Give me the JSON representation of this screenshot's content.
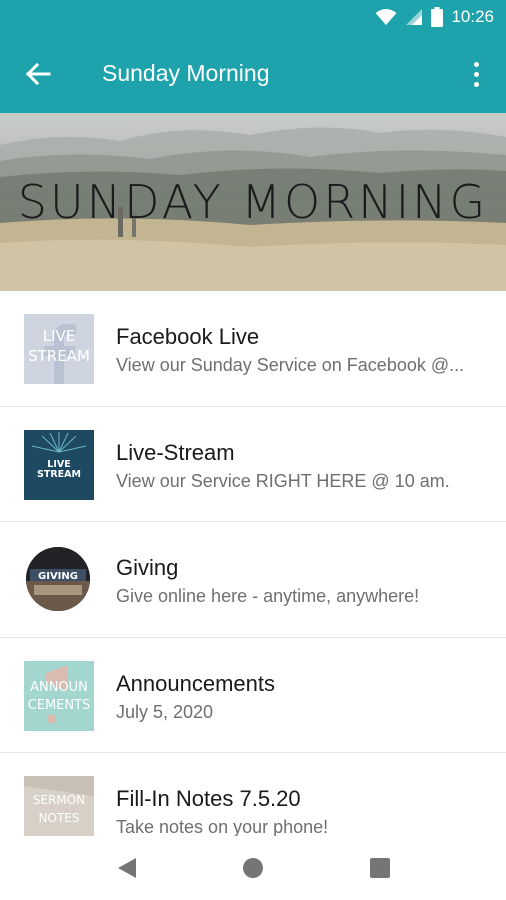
{
  "status_bar": {
    "time": "10:26",
    "icons": [
      "wifi-icon",
      "signal-icon",
      "battery-icon"
    ]
  },
  "app_bar": {
    "title": "Sunday Morning",
    "back_icon": "arrow-left-icon",
    "menu_icon": "more-vertical-icon"
  },
  "hero": {
    "text": "SUNDAY MORNING"
  },
  "items": [
    {
      "title": "Facebook Live",
      "subtitle": "View our Sunday Service on Facebook @...",
      "thumb_text_1": "LIVE",
      "thumb_text_2": "STREAM"
    },
    {
      "title": "Live-Stream",
      "subtitle": "View our Service RIGHT HERE @ 10 am.",
      "thumb_text_1": "LIVE STREAM"
    },
    {
      "title": "Giving",
      "subtitle": "Give online here - anytime, anywhere!",
      "thumb_text_1": "GIVING"
    },
    {
      "title": "Announcements",
      "subtitle": "July 5, 2020",
      "thumb_text_1": "ANNOUN",
      "thumb_text_2": "CEMENTS"
    },
    {
      "title": "Fill-In Notes 7.5.20",
      "subtitle": "Take notes on your phone!",
      "thumb_text_1": "SERMON",
      "thumb_text_2": "NOTES"
    }
  ],
  "nav_bar": {
    "back": "back-triangle-icon",
    "home": "home-circle-icon",
    "recents": "recents-square-icon"
  },
  "colors": {
    "primary": "#1ea3ad",
    "text_primary": "#1a1a1a",
    "text_secondary": "#6f6f6f"
  }
}
